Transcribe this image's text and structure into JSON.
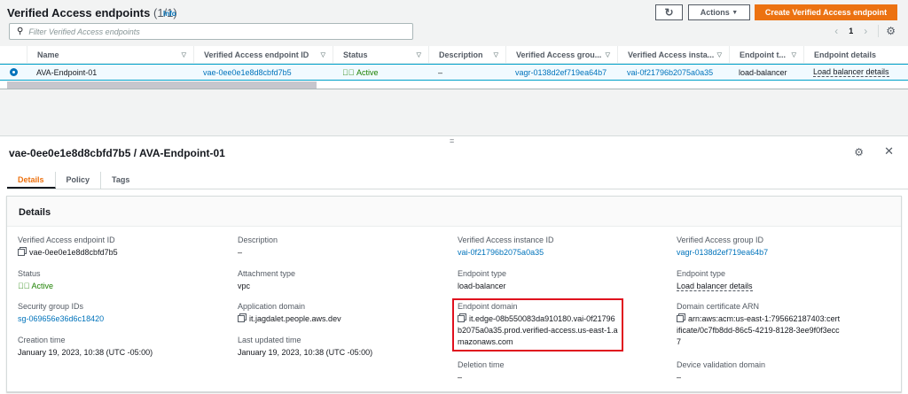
{
  "header": {
    "title": "Verified Access endpoints",
    "count": "(1/1)",
    "info": "Info",
    "actions": "Actions",
    "create": "Create Verified Access endpoint",
    "filter_placeholder": "Filter Verified Access endpoints",
    "page": "1"
  },
  "table": {
    "columns": [
      "Name",
      "Verified Access endpoint ID",
      "Status",
      "Description",
      "Verified Access grou...",
      "Verified Access insta...",
      "Endpoint t...",
      "Endpoint details"
    ],
    "rows": [
      {
        "name": "AVA-Endpoint-01",
        "id": "vae-0ee0e1e8d8cbfd7b5",
        "status": "Active",
        "description": "–",
        "group": "vagr-0138d2ef719ea64b7",
        "instance": "vai-0f21796b2075a0a35",
        "type": "load-balancer",
        "details": "Load balancer details"
      }
    ]
  },
  "detail": {
    "title": "vae-0ee0e1e8d8cbfd7b5 / AVA-Endpoint-01",
    "tabs": [
      "Details",
      "Policy",
      "Tags"
    ],
    "panel_title": "Details",
    "fields": {
      "endpoint_id": {
        "label": "Verified Access endpoint ID",
        "value": "vae-0ee0e1e8d8cbfd7b5"
      },
      "status": {
        "label": "Status",
        "value": "Active"
      },
      "sg": {
        "label": "Security group IDs",
        "value": "sg-069656e36d6c18420"
      },
      "created": {
        "label": "Creation time",
        "value": "January 19, 2023, 10:38 (UTC -05:00)"
      },
      "description": {
        "label": "Description",
        "value": "–"
      },
      "attachment": {
        "label": "Attachment type",
        "value": "vpc"
      },
      "app_domain": {
        "label": "Application domain",
        "value": "it.jagdalet.people.aws.dev"
      },
      "updated": {
        "label": "Last updated time",
        "value": "January 19, 2023, 10:38 (UTC -05:00)"
      },
      "instance": {
        "label": "Verified Access instance ID",
        "value": "vai-0f21796b2075a0a35"
      },
      "etype": {
        "label": "Endpoint type",
        "value": "load-balancer"
      },
      "edomain": {
        "label": "Endpoint domain",
        "value": "it.edge-08b550083da910180.vai-0f21796b2075a0a35.prod.verified-access.us-east-1.amazonaws.com"
      },
      "deletion": {
        "label": "Deletion time",
        "value": "–"
      },
      "group": {
        "label": "Verified Access group ID",
        "value": "vagr-0138d2ef719ea64b7"
      },
      "etype2": {
        "label": "Endpoint type",
        "value": "Load balancer details"
      },
      "cert": {
        "label": "Domain certificate ARN",
        "value": "arn:aws:acm:us-east-1:795662187403:certificate/0c7fb8dd-86c5-4219-8128-3ee9f0f3ecc7"
      },
      "device": {
        "label": "Device validation domain",
        "value": "–"
      }
    }
  }
}
